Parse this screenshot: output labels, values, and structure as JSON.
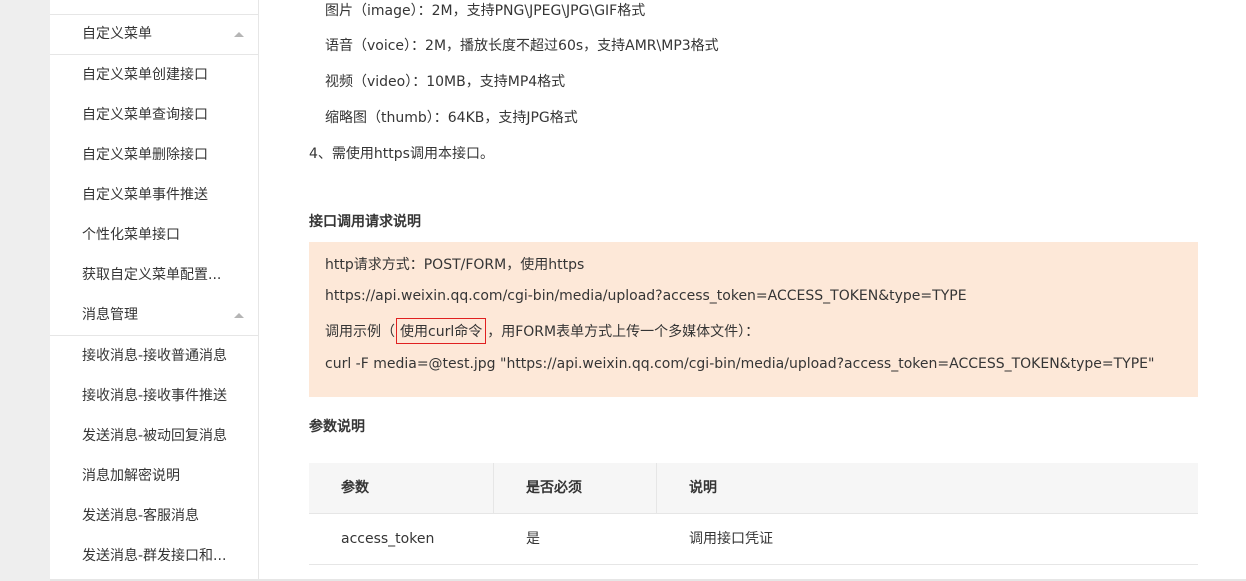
{
  "sidebar": {
    "items": [
      {
        "label": "自定义菜单",
        "type": "section"
      },
      {
        "label": "自定义菜单创建接口",
        "type": "item"
      },
      {
        "label": "自定义菜单查询接口",
        "type": "item"
      },
      {
        "label": "自定义菜单删除接口",
        "type": "item"
      },
      {
        "label": "自定义菜单事件推送",
        "type": "item"
      },
      {
        "label": "个性化菜单接口",
        "type": "item"
      },
      {
        "label": "获取自定义菜单配置...",
        "type": "item"
      },
      {
        "label": "消息管理",
        "type": "section"
      },
      {
        "label": "接收消息-接收普通消息",
        "type": "item"
      },
      {
        "label": "接收消息-接收事件推送",
        "type": "item"
      },
      {
        "label": "发送消息-被动回复消息",
        "type": "item"
      },
      {
        "label": "消息加解密说明",
        "type": "item"
      },
      {
        "label": "发送消息-客服消息",
        "type": "item"
      },
      {
        "label": "发送消息-群发接口和...",
        "type": "item"
      }
    ]
  },
  "content": {
    "format_lines": [
      "图片（image）：2M，支持PNG\\JPEG\\JPG\\GIF格式",
      "语音（voice）：2M，播放长度不超过60s，支持AMR\\MP3格式",
      "视频（video）：10MB，支持MP4格式",
      "缩略图（thumb）：64KB，支持JPG格式"
    ],
    "note_4": "4、需使用https调用本接口。",
    "request_heading": "接口调用请求说明",
    "request": {
      "method": "http请求方式：POST/FORM，使用https",
      "url": "https://api.weixin.qq.com/cgi-bin/media/upload?access_token=ACCESS_TOKEN&type=TYPE",
      "example_prefix": "调用示例（",
      "example_highlight": "使用curl命令",
      "example_suffix": "，用FORM表单方式上传一个多媒体文件）：",
      "curl": "curl -F media=@test.jpg \"https://api.weixin.qq.com/cgi-bin/media/upload?access_token=ACCESS_TOKEN&type=TYPE\""
    },
    "params_heading": "参数说明",
    "params_table": {
      "headers": [
        "参数",
        "是否必须",
        "说明"
      ],
      "rows": [
        [
          "access_token",
          "是",
          "调用接口凭证"
        ]
      ]
    }
  },
  "colors": {
    "request_box_bg": "#fde8d8",
    "highlight_border": "#e02020",
    "table_header_bg": "#f6f6f6"
  }
}
